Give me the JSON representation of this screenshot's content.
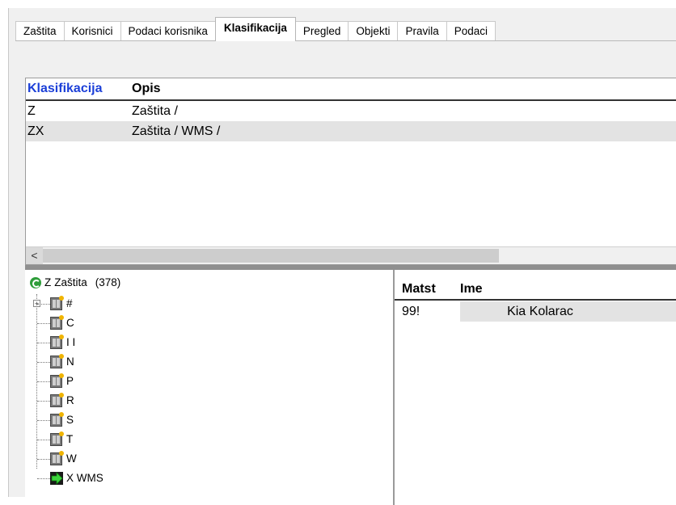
{
  "tabs": [
    {
      "label": "Zaštita",
      "active": false
    },
    {
      "label": "Korisnici",
      "active": false
    },
    {
      "label": "Podaci korisnika",
      "active": false
    },
    {
      "label": "Klasifikacija",
      "active": true
    },
    {
      "label": "Pregled",
      "active": false
    },
    {
      "label": "Objekti",
      "active": false
    },
    {
      "label": "Pravila",
      "active": false
    },
    {
      "label": "Podaci",
      "active": false
    }
  ],
  "classification_grid": {
    "columns": [
      "Klasifikacija",
      "Opis"
    ],
    "rows": [
      {
        "code": "Z",
        "description": "Zaštita /"
      },
      {
        "code": "ZX",
        "description": "Zaštita / WMS /"
      }
    ],
    "scroll_left_glyph": "<"
  },
  "tree": {
    "root": {
      "code": "Z",
      "label": "Zaštita",
      "count": "(378)",
      "icon": "refresh-globe-icon"
    },
    "expander_glyph": "+",
    "nodes": [
      {
        "label": "#",
        "icon": "group-icon"
      },
      {
        "label": "C",
        "icon": "group-icon"
      },
      {
        "label": "I I",
        "icon": "group-icon"
      },
      {
        "label": "N",
        "icon": "group-icon"
      },
      {
        "label": "P",
        "icon": "group-icon"
      },
      {
        "label": "R",
        "icon": "group-icon"
      },
      {
        "label": "S",
        "icon": "group-icon"
      },
      {
        "label": "T",
        "icon": "group-icon"
      },
      {
        "label": "W",
        "icon": "group-icon"
      },
      {
        "label": "X  WMS",
        "icon": "green-arrow-icon"
      }
    ]
  },
  "members_grid": {
    "columns": [
      "Matst",
      "Ime"
    ],
    "rows": [
      {
        "matst": "99!",
        "ime": "Kia Kolarac"
      }
    ]
  },
  "colors": {
    "header_accent": "#1b3fd8",
    "selection": "#e3e3e3",
    "root_icon": "#2e9d3a"
  }
}
